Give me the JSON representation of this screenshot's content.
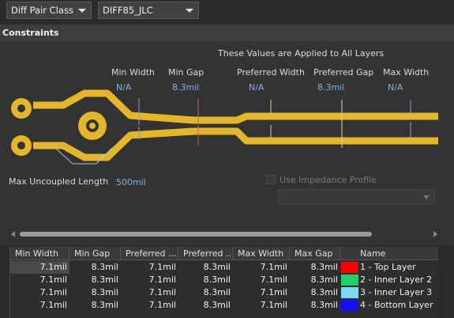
{
  "toolbar": {
    "class_type": "Diff Pair Class",
    "class_name": "DIFF85_JLC"
  },
  "section_title": "Constraints",
  "diagram": {
    "applied_note": "These Values are Applied to All Layers",
    "params": [
      {
        "label": "Min Width",
        "value": "N/A"
      },
      {
        "label": "Min Gap",
        "value": "8.3mil"
      },
      {
        "label": "Preferred Width",
        "value": "N/A"
      },
      {
        "label": "Preferred Gap",
        "value": "8.3mil"
      },
      {
        "label": "Max Width",
        "value": "N/A"
      }
    ],
    "max_uncoupled_label": "Max Uncoupled Length",
    "max_uncoupled_value": "500mil",
    "impedance_label": "Use Impedance Profile",
    "trace_color": "#e3b62b"
  },
  "table": {
    "headers": [
      "Min Width",
      "Min Gap",
      "Preferred ...",
      "Preferred ...",
      "Max Width",
      "Max Gap",
      "Name"
    ],
    "rows": [
      {
        "min_width": "7.1mil",
        "min_gap": "8.3mil",
        "pref_width": "7.1mil",
        "pref_gap": "8.3mil",
        "max_width": "7.1mil",
        "max_gap": "8.3mil",
        "color": "#ff0000",
        "name": "1 - Top Layer"
      },
      {
        "min_width": "7.1mil",
        "min_gap": "8.3mil",
        "pref_width": "7.1mil",
        "pref_gap": "8.3mil",
        "max_width": "7.1mil",
        "max_gap": "8.3mil",
        "color": "#1fd16a",
        "name": "2 - Inner Layer 2"
      },
      {
        "min_width": "7.1mil",
        "min_gap": "8.3mil",
        "pref_width": "7.1mil",
        "pref_gap": "8.3mil",
        "max_width": "7.1mil",
        "max_gap": "8.3mil",
        "color": "#7fd6f5",
        "name": "3 - Inner Layer 3"
      },
      {
        "min_width": "7.1mil",
        "min_gap": "8.3mil",
        "pref_width": "7.1mil",
        "pref_gap": "8.3mil",
        "max_width": "7.1mil",
        "max_gap": "8.3mil",
        "color": "#1010ff",
        "name": "4 - Bottom Layer"
      }
    ]
  }
}
